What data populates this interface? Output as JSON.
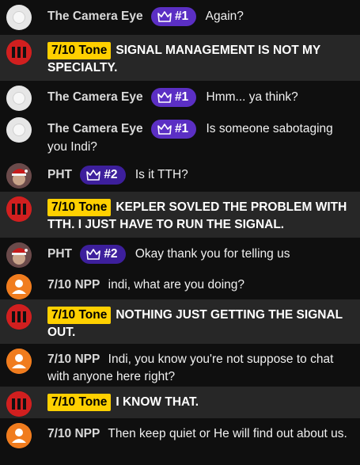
{
  "messages": [
    {
      "type": "camera",
      "name": "The Camera Eye",
      "badge": "#1",
      "text": "Again?"
    },
    {
      "type": "tone",
      "tag": "7/10 Tone",
      "text": "SIGNAL MANAGEMENT IS NOT MY SPECIALTY."
    },
    {
      "type": "camera",
      "name": "The Camera Eye",
      "badge": "#1",
      "text": "Hmm... ya think?"
    },
    {
      "type": "camera",
      "name": "The Camera Eye",
      "badge": "#1",
      "text": "Is someone sabotaging you Indi?"
    },
    {
      "type": "pht",
      "name": "PHT",
      "badge": "#2",
      "text": "Is it TTH?"
    },
    {
      "type": "tone",
      "tag": "7/10 Tone",
      "text": "KEPLER SOVLED THE PROBLEM WITH TTH. I JUST HAVE TO RUN THE SIGNAL."
    },
    {
      "type": "pht",
      "name": "PHT",
      "badge": "#2",
      "text": "Okay thank you for telling us"
    },
    {
      "type": "npp",
      "name": "7/10 NPP",
      "text": "indi, what are you doing?"
    },
    {
      "type": "tone",
      "tag": "7/10 Tone",
      "text": "NOTHING JUST GETTING THE SIGNAL OUT."
    },
    {
      "type": "npp",
      "name": "7/10 NPP",
      "text": "Indi, you know you're not suppose to chat with anyone here right?"
    },
    {
      "type": "tone",
      "tag": "7/10 Tone",
      "text": "I KNOW THAT."
    },
    {
      "type": "npp",
      "name": "7/10 NPP",
      "text": "Then keep quiet or He will find out about us."
    }
  ],
  "colors": {
    "tone_badge": "#ffd000",
    "rank_badge": "#5b2fc4",
    "highlight_row": "#272727",
    "background": "#0f0f0f"
  },
  "icons": {
    "rank": "crown-icon",
    "tone_avatar": "tone-logo-icon",
    "npp_avatar": "person-icon",
    "pht_avatar": "santa-hat-avatar"
  }
}
